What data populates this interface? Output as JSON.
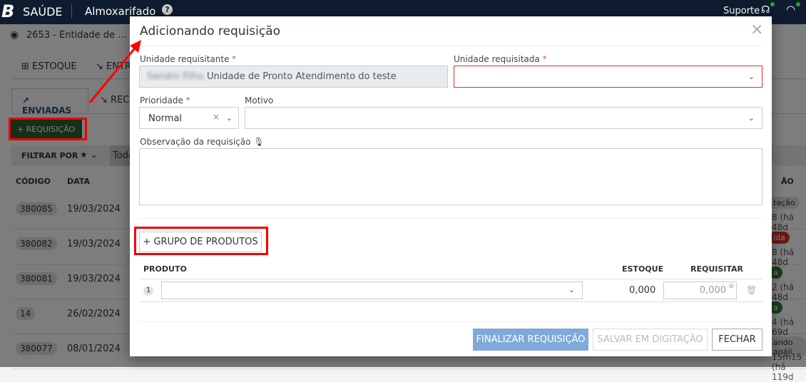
{
  "topbar": {
    "logo": "B",
    "app": "SAÚDE",
    "module": "Almoxarifado",
    "help_icon": "?",
    "support": "Suporte"
  },
  "bg": {
    "entity": "2653 - Entidade de ...",
    "nav": [
      "ESTOQUE",
      "ENTR"
    ],
    "tabs": [
      "ENVIADAS",
      "RECE"
    ],
    "add_button": "+ REQUISIÇÃO",
    "filter_label": "FILTRAR POR",
    "filter_value": "Todo",
    "columns": {
      "code": "CÓDIGO",
      "date": "DATA",
      "status": "ÃO"
    },
    "rows": [
      {
        "code": "380085",
        "date": "19/03/2024",
        "status": "tação",
        "status_color": "#dddddd",
        "time": "8 (há 48d"
      },
      {
        "code": "380082",
        "date": "19/03/2024",
        "status": "ída",
        "status_color": "#d9342b",
        "time": "8 (há 48d"
      },
      {
        "code": "380081",
        "date": "19/03/2024",
        "status": "a",
        "status_color": "#2e7d32",
        "time": "2 (há 48d"
      },
      {
        "code": "14",
        "date": "26/02/2024",
        "status": "a",
        "status_color": "#2e7d32",
        "time": "4 (há 69d"
      },
      {
        "code": "380077",
        "date": "08/01/2024",
        "status": "ando análi",
        "status_color": "#dddddd",
        "time": "15m15 (há 119d"
      }
    ]
  },
  "modal": {
    "title": "Adicionando requisição",
    "close": "×",
    "unidade_requisitante_label": "Unidade requisitante",
    "unidade_requisitante_value": "Unidade de Pronto Atendimento do teste",
    "unidade_requisitada_label": "Unidade requisitada",
    "prioridade_label": "Prioridade",
    "prioridade_value": "Normal",
    "motivo_label": "Motivo",
    "observacao_label": "Observação da requisição",
    "grupo_button": "+ GRUPO DE PRODUTOS",
    "table": {
      "produto": "PRODUTO",
      "estoque": "ESTOQUE",
      "requisitar": "REQUISITAR",
      "rows": [
        {
          "index": "1",
          "estoque": "0,000",
          "requisitar": "0,000"
        }
      ]
    },
    "buttons": {
      "finalizar": "FINALIZAR REQUISIÇÃO",
      "salvar": "SALVAR EM DIGITAÇÃO",
      "fechar": "FECHAR"
    }
  },
  "colors": {
    "primary_green": "#2e5e35",
    "error_red": "#d9342b",
    "finalizar_blue": "#7fa9da",
    "annotation_red": "#ff0000"
  }
}
